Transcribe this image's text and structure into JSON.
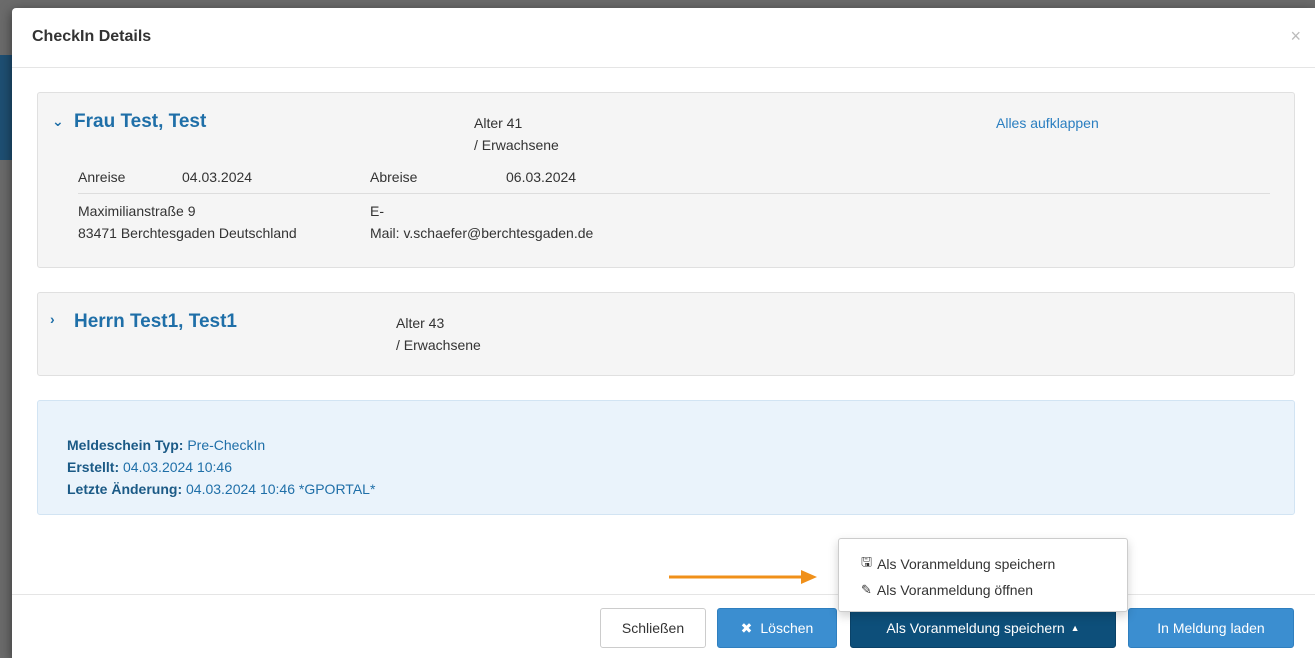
{
  "modal": {
    "title": "CheckIn Details",
    "close_symbol": "×"
  },
  "guests": [
    {
      "name": "Frau Test, Test",
      "age_line1": "Alter 41",
      "age_line2": "/ Erwachsene",
      "expand_all_label": "Alles aufklappen",
      "arrival_label": "Anreise",
      "arrival_date": "04.03.2024",
      "departure_label": "Abreise",
      "departure_date": "06.03.2024",
      "address_line1": "Maximilianstraße 9",
      "address_line2": "83471 Berchtesgaden Deutschland",
      "email_line1": "E-",
      "email_line2": "Mail: v.schaefer@berchtesgaden.de"
    },
    {
      "name": "Herrn Test1, Test1",
      "age_line1": "Alter 43",
      "age_line2": "/ Erwachsene"
    }
  ],
  "info": {
    "type_label": "Meldeschein Typ:",
    "type_value": "Pre-CheckIn",
    "created_label": "Erstellt:",
    "created_value": "04.03.2024 10:46",
    "changed_label": "Letzte Änderung:",
    "changed_value": "04.03.2024 10:46 *GPORTAL*"
  },
  "footer": {
    "close_label": "Schließen",
    "delete_label": "Löschen",
    "save_label": "Als Voranmeldung speichern",
    "load_label": "In Meldung laden"
  },
  "dropdown": {
    "items": [
      {
        "label": "Als Voranmeldung speichern",
        "icon": "floppy-disk-icon"
      },
      {
        "label": "Als Voranmeldung öffnen",
        "icon": "pencil-icon"
      }
    ]
  },
  "colors": {
    "primary": "#3b8ed0",
    "primary_dark": "#0d4f7a",
    "link": "#1f6fa8",
    "annotation_arrow": "#f0901a"
  }
}
